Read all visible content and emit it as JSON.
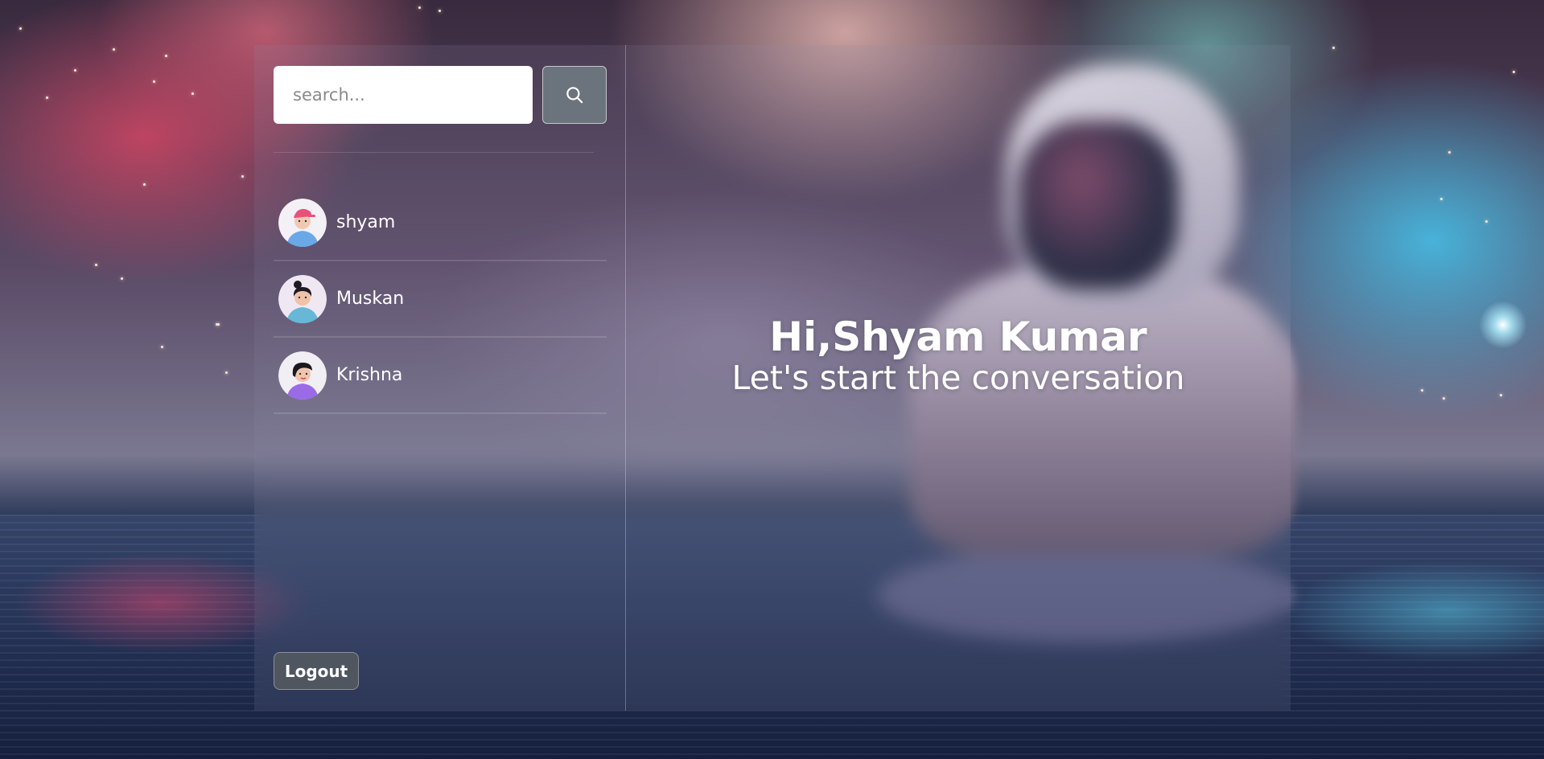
{
  "search": {
    "placeholder": "search...",
    "value": ""
  },
  "users": [
    {
      "name": "shyam",
      "avatar_icon": "avatar-male-pink-cap-icon"
    },
    {
      "name": "Muskan",
      "avatar_icon": "avatar-female-bun-icon"
    },
    {
      "name": "Krishna",
      "avatar_icon": "avatar-female-purple-icon"
    }
  ],
  "logout": {
    "label": "Logout"
  },
  "welcome": {
    "greeting": "Hi,Shyam Kumar",
    "subtitle": "Let's start the conversation"
  },
  "colors": {
    "search_button_bg": "#6b737d",
    "logout_bg": "#4f565f",
    "text": "#ffffff"
  }
}
